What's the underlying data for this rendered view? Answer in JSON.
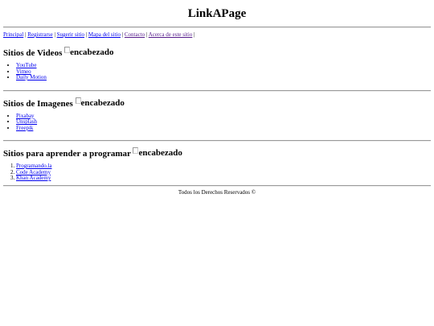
{
  "site": {
    "title": "LinkAPage"
  },
  "nav": {
    "items": [
      {
        "label": "Principal"
      },
      {
        "label": "Registrarse"
      },
      {
        "label": "Sugerir sitio"
      },
      {
        "label": "Mapa del sitio"
      },
      {
        "label": "Contacto"
      },
      {
        "label": "Acerca de este sitio"
      }
    ],
    "separator": "|"
  },
  "sections": [
    {
      "heading": "Sitios de Videos",
      "img_alt": "encabezado",
      "links": [
        "YouTube",
        "Vimeo",
        "Daily Motion"
      ]
    },
    {
      "heading": "Sitios de Imagenes",
      "img_alt": "encabezado",
      "links": [
        "Pixabay",
        "Unsplash",
        "Freepik"
      ]
    },
    {
      "heading": "Sitios para aprender a programar",
      "img_alt": "encabezado",
      "links": [
        "Programando.la",
        "Code Academy",
        "Khan Academy"
      ]
    }
  ],
  "footer": {
    "text": "Todos los Derechos Reservados ©"
  }
}
